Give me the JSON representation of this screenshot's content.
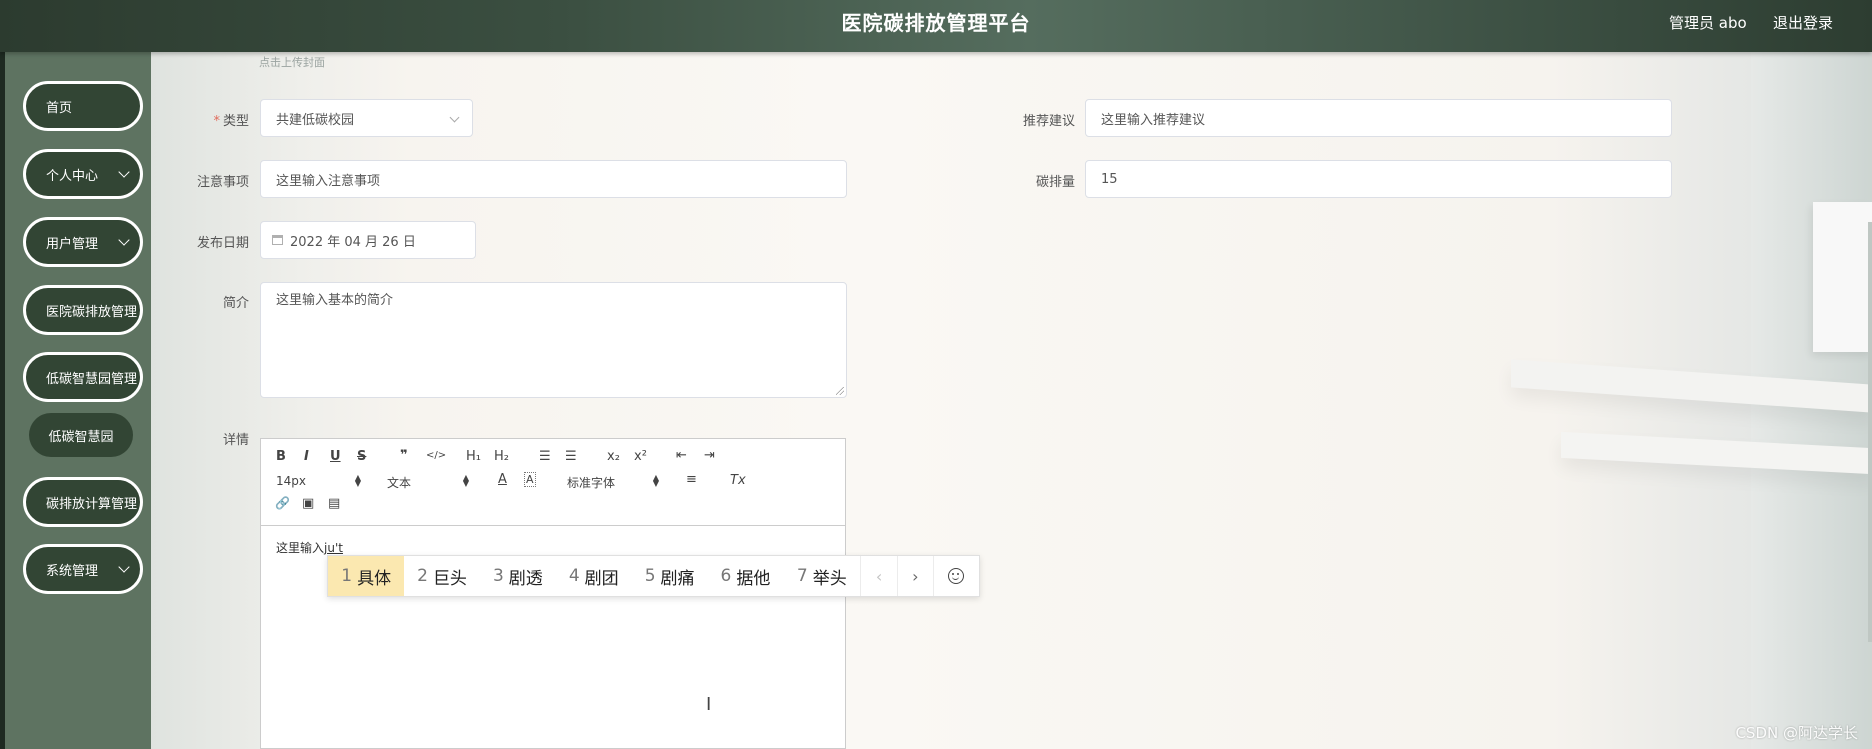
{
  "header": {
    "title": "医院碳排放管理平台",
    "admin_label": "管理员 abo",
    "logout_label": "退出登录"
  },
  "sidebar": {
    "items": [
      {
        "label": "首页"
      },
      {
        "label": "个人中心"
      },
      {
        "label": "用户管理"
      },
      {
        "label": "医院碳排放管理"
      },
      {
        "label": "低碳智慧园管理"
      },
      {
        "label": "低碳智慧园"
      },
      {
        "label": "碳排放计算管理"
      },
      {
        "label": "系统管理"
      }
    ]
  },
  "form": {
    "upload_hint": "点击上传封面",
    "type": {
      "label": "类型",
      "value": "共建低碳校园"
    },
    "recommend": {
      "label": "推荐建议",
      "placeholder": "这里输入推荐建议"
    },
    "notes": {
      "label": "注意事项",
      "placeholder": "这里输入注意事项"
    },
    "carbon": {
      "label": "碳排量",
      "value": "15"
    },
    "publish_date": {
      "label": "发布日期",
      "value": "2022 年 04 月 26 日"
    },
    "intro": {
      "label": "简介",
      "placeholder": "这里输入基本的简介"
    },
    "detail": {
      "label": "详情"
    }
  },
  "editor": {
    "toolbar": {
      "bold": "B",
      "italic": "I",
      "underline": "U",
      "strike": "S",
      "quote": "❞",
      "code": "</>",
      "h1": "H₁",
      "h2": "H₂",
      "ol": "☰",
      "ul": "☰",
      "sub": "x₂",
      "sup": "x²",
      "indent_out": "⇤",
      "indent_in": "⇥",
      "size": "14px",
      "format": "文本",
      "color": "A",
      "bg": "A",
      "font": "标准字体",
      "align": "≡",
      "clear": "Tx",
      "link": "🔗",
      "image": "▣",
      "video": "▤"
    },
    "content": "这里输入",
    "ime_input": "ju't"
  },
  "ime": {
    "candidates": [
      {
        "num": "1",
        "text": "具体"
      },
      {
        "num": "2",
        "text": "巨头"
      },
      {
        "num": "3",
        "text": "剧透"
      },
      {
        "num": "4",
        "text": "剧团"
      },
      {
        "num": "5",
        "text": "剧痛"
      },
      {
        "num": "6",
        "text": "据他"
      },
      {
        "num": "7",
        "text": "举头"
      }
    ],
    "prev": "‹",
    "next": "›"
  },
  "watermark": "CSDN @阿达学长",
  "colors": {
    "header": "#3b4f41",
    "sidebar": "#5e7361",
    "nav_pill": "#324534",
    "ime_selected": "#fbe8b0"
  }
}
